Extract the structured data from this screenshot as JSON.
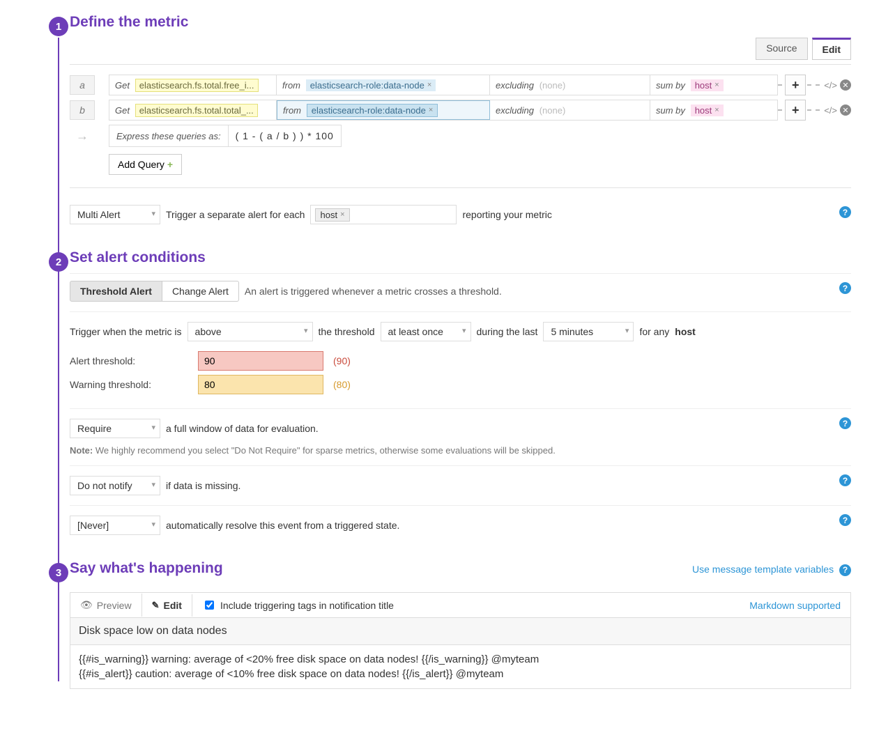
{
  "step1": {
    "number": "1",
    "title": "Define the metric",
    "tabs": {
      "source": "Source",
      "edit": "Edit"
    },
    "queries": [
      {
        "letter": "a",
        "get": "Get",
        "metric": "elasticsearch.fs.total.free_i...",
        "from": "from",
        "scope": "elasticsearch-role:data-node",
        "excluding": "excluding",
        "none": "(none)",
        "sumby": "sum by",
        "host": "host"
      },
      {
        "letter": "b",
        "get": "Get",
        "metric": "elasticsearch.fs.total.total_...",
        "from": "from",
        "scope": "elasticsearch-role:data-node",
        "excluding": "excluding",
        "none": "(none)",
        "sumby": "sum by",
        "host": "host"
      }
    ],
    "express_label": "Express these queries as:",
    "express_value": "( 1 - ( a / b ) ) * 100",
    "add_query": "Add Query",
    "multi_alert": "Multi Alert",
    "multi_alert_text_a": "Trigger a separate alert for each",
    "multi_alert_tag": "host",
    "multi_alert_text_b": "reporting your metric"
  },
  "step2": {
    "number": "2",
    "title": "Set alert conditions",
    "threshold_btn": "Threshold Alert",
    "change_btn": "Change Alert",
    "toggle_desc": "An alert is triggered whenever a metric crosses a threshold.",
    "trigger_a": "Trigger when the metric is",
    "trigger_select": "above",
    "trigger_b": "the threshold",
    "freq_select": "at least once",
    "trigger_c": "during the last",
    "time_select": "5 minutes",
    "trigger_d": "for any",
    "trigger_e": "host",
    "alert_label": "Alert threshold:",
    "alert_value": "90",
    "alert_disp": "(90)",
    "warn_label": "Warning threshold:",
    "warn_value": "80",
    "warn_disp": "(80)",
    "require_select": "Require",
    "require_text": "a full window of data for evaluation.",
    "note_label": "Note:",
    "note_text": "We highly recommend you select \"Do Not Require\" for sparse metrics, otherwise some evaluations will be skipped.",
    "notify_select": "Do not notify",
    "notify_text": "if data is missing.",
    "resolve_select": "[Never]",
    "resolve_text": "automatically resolve this event from a triggered state."
  },
  "step3": {
    "number": "3",
    "title": "Say what's happening",
    "templates_link": "Use message template variables",
    "preview_tab": "Preview",
    "edit_tab": "Edit",
    "include_tags": "Include triggering tags in notification title",
    "markdown": "Markdown supported",
    "msg_title": "Disk space low on data nodes",
    "msg_line1": "{{#is_warning}} warning: average of <20% free disk space on data nodes! {{/is_warning}} @myteam",
    "msg_line2": "{{#is_alert}} caution: average of <10% free disk space on data nodes! {{/is_alert}} @myteam"
  }
}
